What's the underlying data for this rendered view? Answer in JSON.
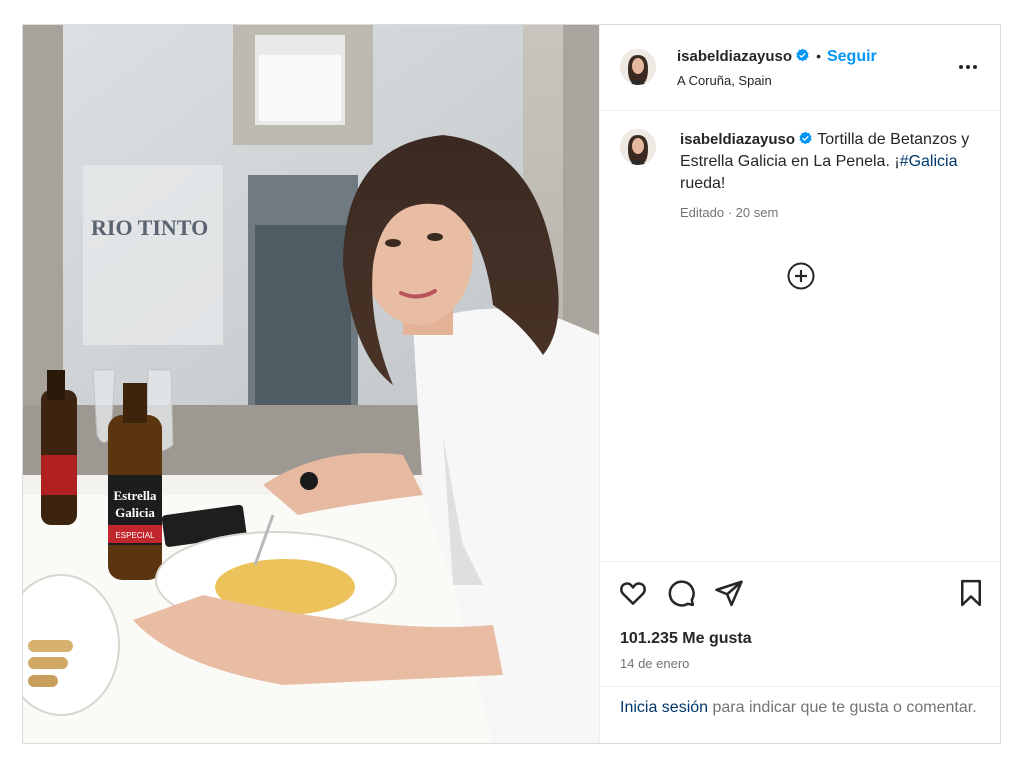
{
  "post": {
    "username": "isabeldiazayuso",
    "verified": true,
    "dot": "•",
    "follow_label": "Seguir",
    "location": "A Coruña, Spain",
    "more_icon": "more-horizontal-icon"
  },
  "caption": {
    "username": "isabeldiazayuso",
    "text_before": "Tortilla de Betanzos y Estrella Galicia en La Penela. ¡",
    "hashtag": "#Galicia",
    "text_after": " rueda!",
    "meta": "Editado · 20 sem",
    "add_icon": "circle-plus-icon"
  },
  "photo": {
    "sign_text": "RIO TINTO",
    "beer_label_top": "Estrella",
    "beer_label_bottom": "Galicia",
    "beer_label_sub": "ESPECIAL"
  },
  "actions": {
    "like_icon": "heart-icon",
    "comment_icon": "comment-icon",
    "share_icon": "send-icon",
    "save_icon": "bookmark-icon",
    "likes": "101.235 Me gusta",
    "date": "14 de enero"
  },
  "login": {
    "link": "Inicia sesión",
    "rest": " para indicar que te gusta o comentar."
  },
  "colors": {
    "accent": "#0095f6",
    "hashtag": "#00376b",
    "secondary_text": "#737373",
    "verified_badge": "#0095f6"
  }
}
